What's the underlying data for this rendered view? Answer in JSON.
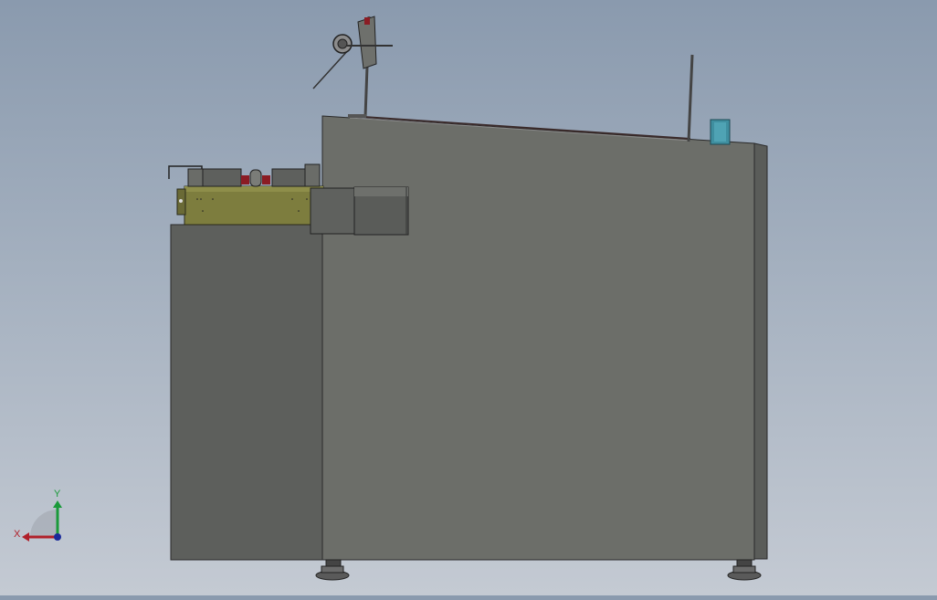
{
  "viewport": {
    "background_top": "#8a9aae",
    "background_bottom": "#c4cad3"
  },
  "triad": {
    "x_label": "X",
    "y_label": "Y",
    "x_color": "#b0202a",
    "y_color": "#1a9a3a",
    "origin_color": "#1a2a9a"
  },
  "model": {
    "cabinet_color": "#6c6e69",
    "side_panel_color": "#5d5f5c",
    "rail_color": "#7d7d3e",
    "accent_red": "#8b1c24",
    "teal_box_color": "#3f8fa0"
  }
}
